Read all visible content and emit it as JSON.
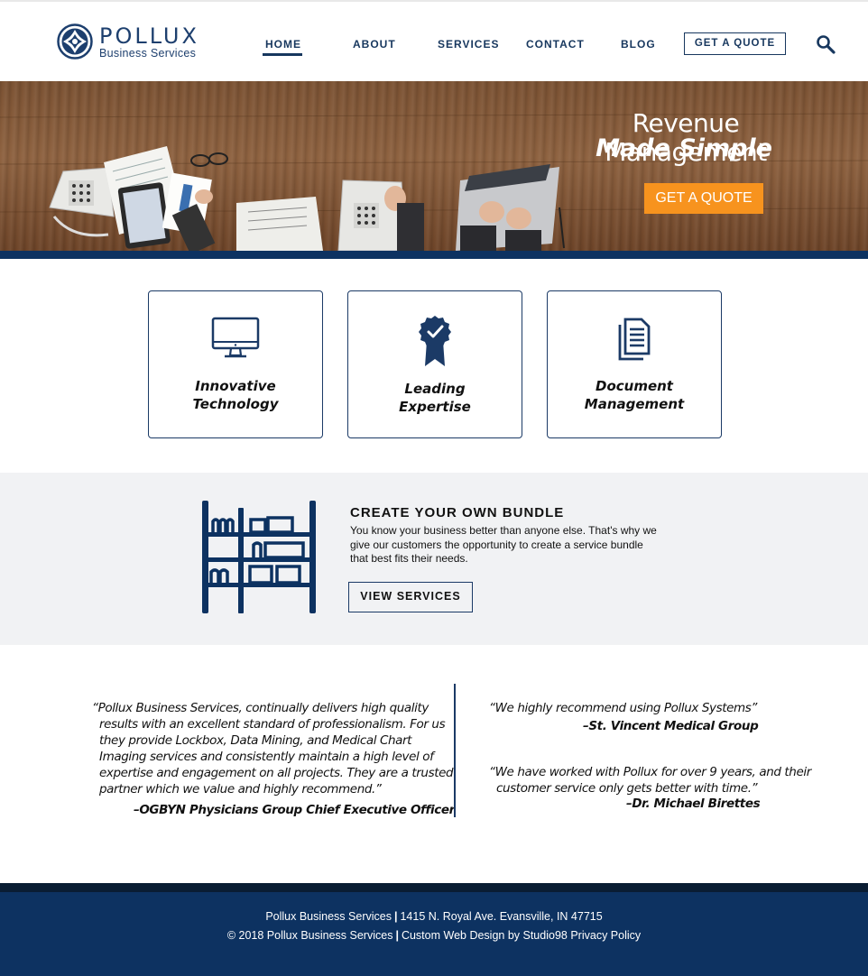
{
  "header": {
    "logo_name": "POLLUX",
    "logo_sub": "Business Services",
    "nav": {
      "home": "HOME",
      "about": "ABOUT",
      "services": "SERVICES",
      "contact": "CONTACT",
      "blog": "BLOG",
      "quote": "GET A QUOTE"
    },
    "active_nav": "HOME"
  },
  "hero": {
    "title_line1": "Revenue Management",
    "title_line2": "Made Simple",
    "cta": "GET A QUOTE"
  },
  "features": [
    {
      "icon": "monitor-icon",
      "line1": "Innovative",
      "line2": "Technology"
    },
    {
      "icon": "award-badge-icon",
      "line1": "Leading",
      "line2": "Expertise"
    },
    {
      "icon": "document-icon",
      "line1": "Document",
      "line2": "Management"
    }
  ],
  "bundle": {
    "icon": "shelf-icon",
    "title": "CREATE YOUR OWN BUNDLE",
    "line1": "You know your business better than anyone else. That's why we",
    "line2": "give our customers the opportunity to create a service bundle",
    "line3": "that best fits their needs.",
    "button": "VIEW SERVICES"
  },
  "testimonials": {
    "left": {
      "line1": "“Pollux Business Services, continually delivers high quality",
      "line2": "results with an excellent standard of professionalism. For us",
      "line3": "they provide Lockbox, Data Mining, and Medical Chart",
      "line4": "Imaging services and consistently maintain a high level of",
      "line5": "expertise and engagement on all projects. They are a trusted",
      "line6": "partner which we value and highly recommend.”",
      "attribution": "–OGBYN Physicians Group Chief Executive Officer"
    },
    "right_top": {
      "line1": "“We highly recommend using Pollux Systems”",
      "attribution": "–St. Vincent Medical Group"
    },
    "right_bottom": {
      "line1": "“We have worked with Pollux for over 9 years, and their",
      "line2": "customer service only gets better with time.”",
      "attribution": "–Dr. Michael Birettes"
    }
  },
  "footer": {
    "company": "Pollux Business Services",
    "address": "1415 N. Royal Ave. Evansville, IN 47715",
    "copyright": "© 2018 Pollux Business Services",
    "design_credit": "Custom Web Design by Studio98",
    "privacy": "Privacy Policy",
    "separator": "|"
  },
  "colors": {
    "navy": "#0d3261",
    "orange": "#f7931e",
    "band_gray": "#f1f2f4"
  }
}
